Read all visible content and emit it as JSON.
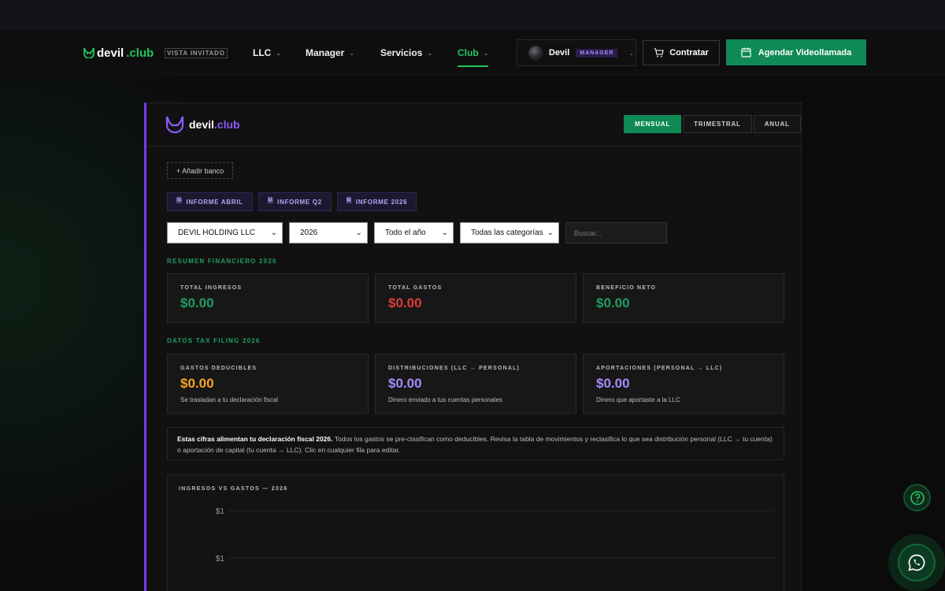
{
  "nav": {
    "brand": {
      "prefix": "devil",
      "suffix": ".club"
    },
    "guest_tag": "VISTA INVITADO",
    "items": [
      {
        "label": "LLC"
      },
      {
        "label": "Manager"
      },
      {
        "label": "Servicios"
      },
      {
        "label": "Club",
        "active": true
      }
    ],
    "user": {
      "name": "Devil",
      "role": "MANAGER"
    },
    "hire_label": "Contratar",
    "call_label": "Agendar Videollamada"
  },
  "panel": {
    "brand": {
      "prefix": "devil",
      "suffix": ".club"
    },
    "periods": [
      {
        "label": "MENSUAL",
        "active": true
      },
      {
        "label": "TRIMESTRAL"
      },
      {
        "label": "ANUAL"
      }
    ],
    "add_bank_label": "+ Añadir banco",
    "reports": [
      {
        "label": "INFORME ABRIL"
      },
      {
        "label": "INFORME Q2"
      },
      {
        "label": "INFORME 2026"
      }
    ],
    "filters": {
      "company": "DEVIL HOLDING LLC",
      "year": "2026",
      "period": "Todo el año",
      "category": "Todas las categorías",
      "search_placeholder": "Buscar..."
    },
    "summary": {
      "title": "RESUMEN FINANCIERO 2026",
      "cards": [
        {
          "label": "TOTAL INGRESOS",
          "value": "$0.00"
        },
        {
          "label": "TOTAL GASTOS",
          "value": "$0.00"
        },
        {
          "label": "BENEFICIO NETO",
          "value": "$0.00"
        }
      ]
    },
    "tax": {
      "title": "DATOS TAX FILING 2026",
      "cards": [
        {
          "label": "GASTOS DEDUCIBLES",
          "value": "$0.00",
          "sub": "Se trasladan a tu declaración fiscal"
        },
        {
          "label": "DISTRIBUCIONES (LLC → PERSONAL)",
          "value": "$0.00",
          "sub": "Dinero enviado a tus cuentas personales"
        },
        {
          "label": "APORTACIONES (PERSONAL → LLC)",
          "value": "$0.00",
          "sub": "Dinero que aportaste a la LLC"
        }
      ]
    },
    "notice": {
      "bold": "Estas cifras alimentan tu declaración fiscal 2026.",
      "text": " Todos los gastos se pre-clasifican como deducibles. Revisa la tabla de movimientos y reclasifica lo que sea distribución personal (LLC → tu cuenta) o aportación de capital (tu cuenta → LLC). Clic en cualquier fila para editar."
    }
  },
  "chart_data": {
    "type": "line",
    "title": "INGRESOS VS GASTOS — 2026",
    "y_tick_labels": [
      "$1",
      "$1"
    ],
    "series": []
  },
  "colors": {
    "brand_green": "#1f9d63",
    "brand_purple": "#7c3aed",
    "expense_red": "#e03a3a",
    "deductible_orange": "#f5a623"
  },
  "icons": {
    "help": "question-circle-icon",
    "whatsapp": "whatsapp-icon"
  }
}
